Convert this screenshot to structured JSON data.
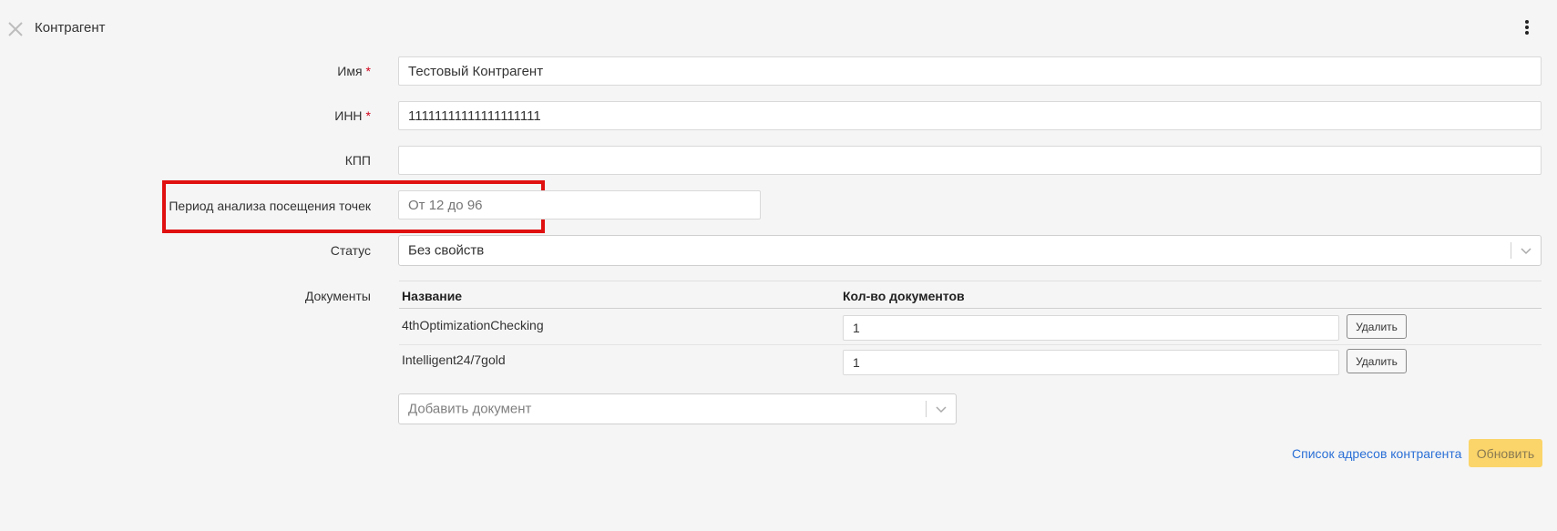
{
  "header": {
    "title": "Контрагент"
  },
  "form": {
    "name": {
      "label": "Имя",
      "required_mark": "*",
      "value": "Тестовый Контрагент"
    },
    "inn": {
      "label": "ИНН",
      "required_mark": "*",
      "value": "11111111111111111111"
    },
    "kpp": {
      "label": "КПП",
      "value": ""
    },
    "visit_period": {
      "label": "Период анализа посещения точек",
      "placeholder": "От 12 до 96"
    },
    "status": {
      "label": "Статус",
      "value": "Без свойств"
    }
  },
  "documents": {
    "label": "Документы",
    "columns": [
      "Название",
      "Кол-во документов"
    ],
    "rows": [
      {
        "name": "4thOptimizationChecking",
        "count": "1",
        "delete_label": "Удалить"
      },
      {
        "name": "Intelligent24/7gold",
        "count": "1",
        "delete_label": "Удалить"
      }
    ],
    "add_placeholder": "Добавить документ"
  },
  "footer": {
    "address_link": "Список адресов контрагента",
    "update_button": "Обновить"
  },
  "colors": {
    "highlight": "#e01010",
    "required": "#d0021b",
    "link": "#2a6fd6",
    "update_button": "#fbd56a"
  }
}
